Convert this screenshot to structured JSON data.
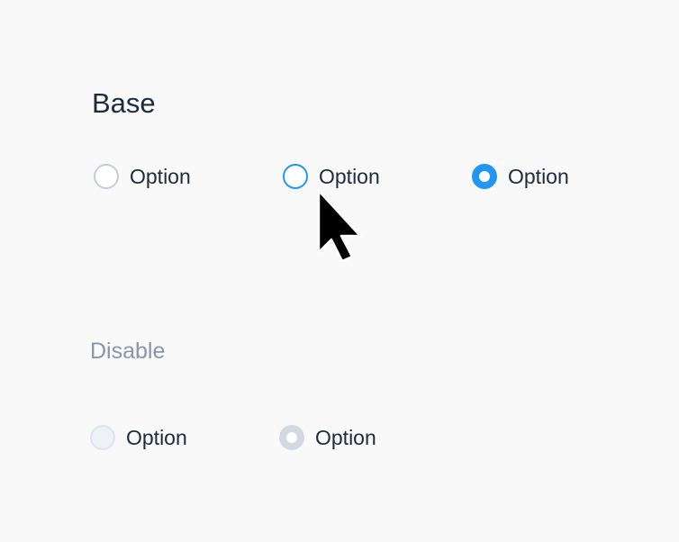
{
  "base": {
    "title": "Base",
    "options": [
      {
        "label": "Option",
        "state": "unchecked"
      },
      {
        "label": "Option",
        "state": "hover"
      },
      {
        "label": "Option",
        "state": "checked"
      }
    ]
  },
  "disabled": {
    "title": "Disable",
    "options": [
      {
        "label": "Option",
        "state": "disabled-unchecked"
      },
      {
        "label": "Option",
        "state": "disabled-checked"
      }
    ]
  },
  "colors": {
    "accent": "#2196f3",
    "text": "#1f2a3d",
    "muted_title": "#8a96a8",
    "border": "#c6ccd6",
    "disabled_fill": "#eef1f5",
    "disabled_checked": "#d2d9e3",
    "background": "#f9f9f9"
  },
  "cursor": {
    "icon": "arrow-cursor-icon"
  }
}
